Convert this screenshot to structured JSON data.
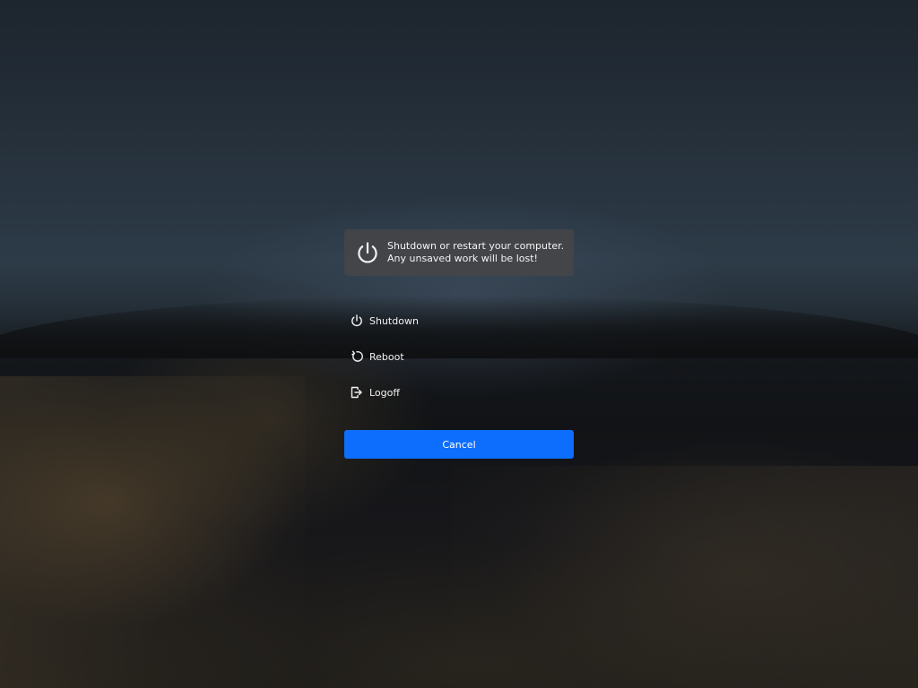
{
  "notice": {
    "line1": "Shutdown or restart your computer.",
    "line2": "Any unsaved work will be lost!",
    "icon": "power-icon"
  },
  "actions": [
    {
      "label": "Shutdown",
      "icon": "power-icon"
    },
    {
      "label": "Reboot",
      "icon": "reboot-icon"
    },
    {
      "label": "Logoff",
      "icon": "logoff-icon"
    }
  ],
  "cancel": {
    "label": "Cancel"
  },
  "colors": {
    "accent": "#0d6efd",
    "notice_bg": "#464648",
    "text": "#f2f2f2"
  }
}
